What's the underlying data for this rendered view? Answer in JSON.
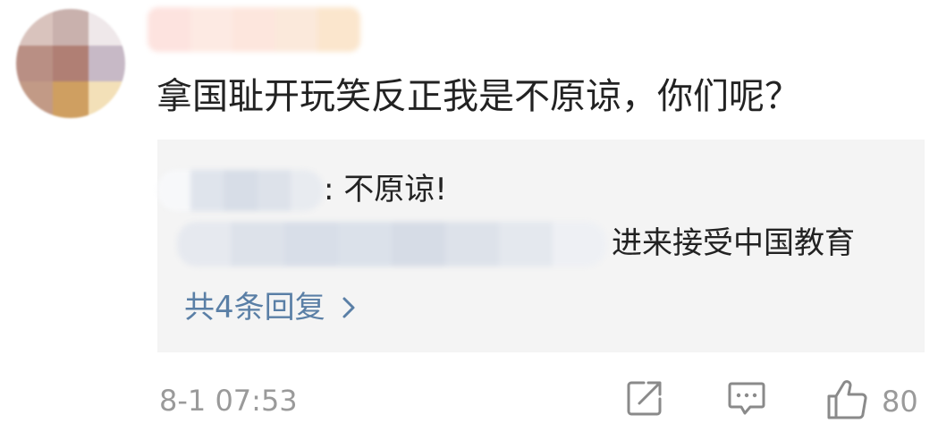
{
  "comment": {
    "text": "拿国耻开玩笑反正我是不原谅，你们呢？",
    "time": "8-1 07:53",
    "like_count": "80"
  },
  "replies": [
    {
      "text": ": 不原谅!"
    },
    {
      "text": "进来接受中国教育"
    }
  ],
  "more_replies_label": "共4条回复",
  "icons": {
    "repost": "share-square-icon",
    "comment": "comment-bubble-icon",
    "like": "thumbs-up-icon",
    "more": "chevron-right-icon"
  },
  "colors": {
    "link": "#5a7fa6",
    "meta": "#9a9a9a",
    "text": "#222222",
    "reply_bg": "#f4f4f4"
  }
}
